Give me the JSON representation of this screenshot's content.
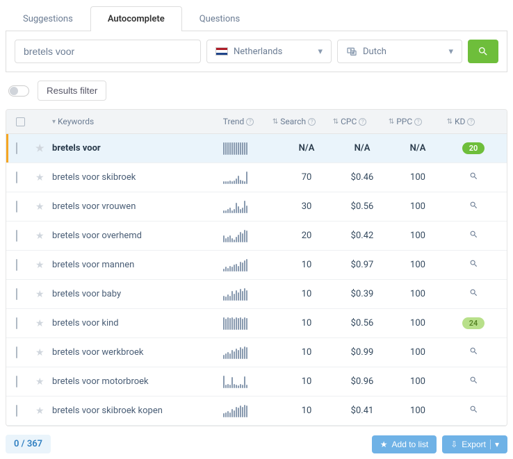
{
  "tabs": {
    "suggestions": "Suggestions",
    "autocomplete": "Autocomplete",
    "questions": "Questions"
  },
  "search": {
    "value": "bretels voor",
    "country": "Netherlands",
    "language": "Dutch"
  },
  "filter": {
    "label": "Results filter"
  },
  "columns": {
    "keywords": "Keywords",
    "trend": "Trend",
    "search": "Search",
    "cpc": "CPC",
    "ppc": "PPC",
    "kd": "KD"
  },
  "rows": [
    {
      "keyword": "bretels voor",
      "highlight": true,
      "trend": [
        1,
        1,
        1,
        1,
        1,
        1,
        1,
        1,
        1,
        1,
        1,
        1
      ],
      "search": "N/A",
      "cpc": "N/A",
      "ppc": "N/A",
      "kd": 20,
      "kdStyle": "green"
    },
    {
      "keyword": "bretels voor skibroek",
      "trend": [
        1,
        1,
        1,
        2,
        1,
        2,
        4,
        7,
        3,
        2,
        1,
        12
      ],
      "search": "70",
      "cpc": "$0.46",
      "ppc": "100",
      "kd": null
    },
    {
      "keyword": "bretels voor vrouwen",
      "trend": [
        1,
        1,
        2,
        3,
        1,
        2,
        7,
        4,
        2,
        3,
        9,
        5
      ],
      "search": "30",
      "cpc": "$0.56",
      "ppc": "100",
      "kd": null
    },
    {
      "keyword": "bretels voor overhemd",
      "trend": [
        4,
        2,
        3,
        4,
        2,
        1,
        3,
        5,
        7,
        6,
        9,
        8
      ],
      "search": "20",
      "cpc": "$0.42",
      "ppc": "100",
      "kd": null
    },
    {
      "keyword": "bretels voor mannen",
      "trend": [
        1,
        3,
        2,
        4,
        3,
        5,
        6,
        4,
        8,
        7,
        9,
        11
      ],
      "search": "10",
      "cpc": "$0.97",
      "ppc": "100",
      "kd": null
    },
    {
      "keyword": "bretels voor baby",
      "trend": [
        3,
        2,
        4,
        3,
        7,
        5,
        8,
        6,
        9,
        7,
        10,
        8
      ],
      "search": "10",
      "cpc": "$0.39",
      "ppc": "100",
      "kd": null
    },
    {
      "keyword": "bretels voor kind",
      "trend": [
        12,
        10,
        12,
        11,
        12,
        10,
        12,
        11,
        12,
        10,
        12,
        11
      ],
      "search": "10",
      "cpc": "$0.56",
      "ppc": "100",
      "kd": 24,
      "kdStyle": "light"
    },
    {
      "keyword": "bretels voor werkbroek",
      "trend": [
        2,
        3,
        4,
        3,
        6,
        5,
        7,
        6,
        8,
        7,
        9,
        8
      ],
      "search": "10",
      "cpc": "$0.99",
      "ppc": "100",
      "kd": null
    },
    {
      "keyword": "bretels voor motorbroek",
      "trend": [
        12,
        2,
        3,
        2,
        10,
        3,
        2,
        1,
        3,
        2,
        11,
        2
      ],
      "search": "10",
      "cpc": "$0.96",
      "ppc": "100",
      "kd": null
    },
    {
      "keyword": "bretels voor skibroek kopen",
      "trend": [
        2,
        3,
        4,
        3,
        6,
        5,
        8,
        7,
        9,
        8,
        10,
        9
      ],
      "search": "10",
      "cpc": "$0.41",
      "ppc": "100",
      "kd": null
    }
  ],
  "footer": {
    "count": "0 / 367",
    "add": "Add to list",
    "export": "Export"
  }
}
